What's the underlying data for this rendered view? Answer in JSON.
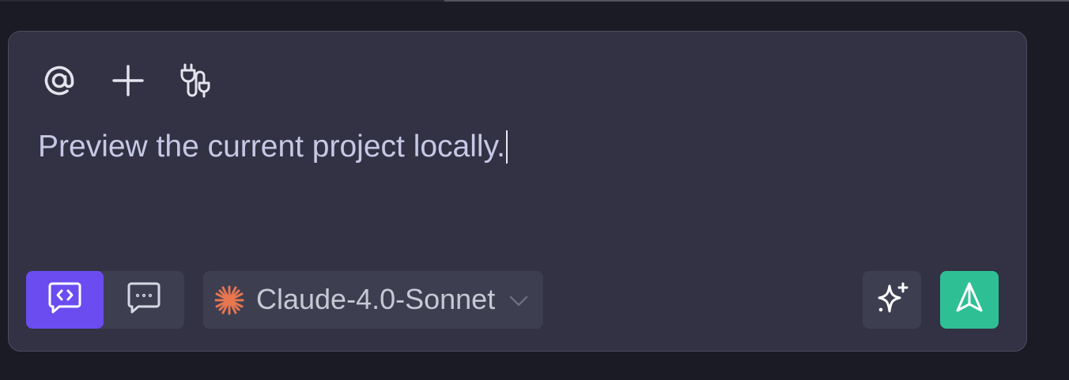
{
  "composer": {
    "prompt_text": "Preview the current project locally.",
    "toolbar_icons": [
      "at-sign-icon",
      "plus-icon",
      "plug-icon"
    ],
    "modes": [
      {
        "name": "code-mode",
        "icon": "code-chat-icon",
        "active": true
      },
      {
        "name": "chat-mode",
        "icon": "message-dots-icon",
        "active": false
      }
    ],
    "model": {
      "label": "Claude-4.0-Sonnet",
      "icon": "claude-starburst-icon",
      "dropdown_icon": "chevron-down-icon"
    },
    "actions": [
      {
        "name": "enhance",
        "icon": "sparkle-icon"
      },
      {
        "name": "send",
        "icon": "send-icon"
      }
    ]
  },
  "colors": {
    "background": "#1b1b25",
    "panel": "#323244",
    "panel_border": "#4b4b5d",
    "control_bg": "#3e3e51",
    "active_mode": "#6a4cf0",
    "send_button": "#2fbf94",
    "prompt_text": "#c7c8e6",
    "claude_orange": "#e8764f"
  }
}
